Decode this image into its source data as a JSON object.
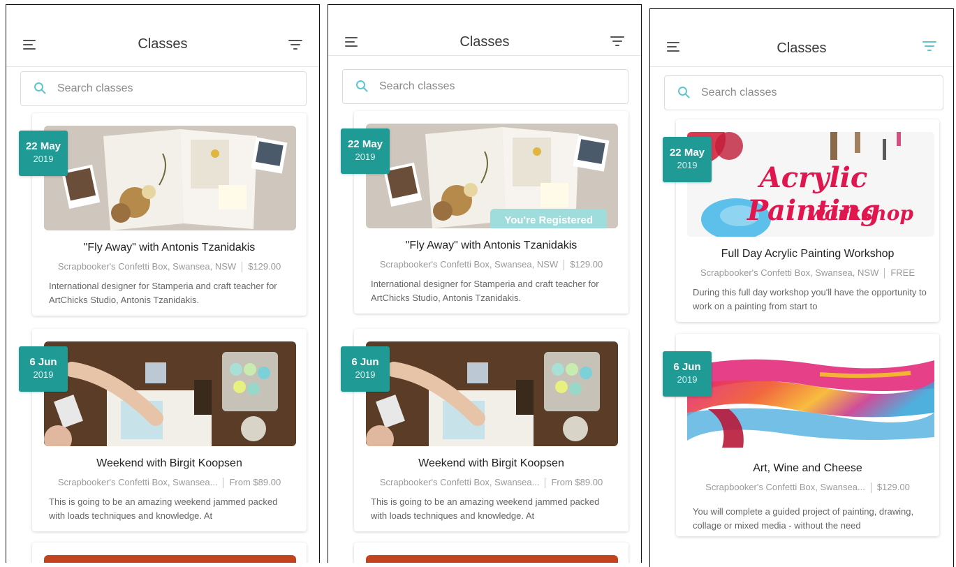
{
  "app": {
    "title": "Classes",
    "search_placeholder": "Search classes",
    "accent_color": "#1f9a95",
    "filter_active_color": "#5fc6cb"
  },
  "panels": [
    {
      "classes": [
        {
          "date_day": "22 May",
          "date_year": "2019",
          "title": "\"Fly Away\" with Antonis Tzanidakis",
          "location": "Scrapbooker's Confetti Box, Swansea, NSW",
          "price": "$129.00",
          "description": "International designer for Stamperia and craft teacher for ArtChicks Studio, Antonis Tzanidakis.",
          "image": "journal-flatlay"
        },
        {
          "date_day": "6 Jun",
          "date_year": "2019",
          "title": "Weekend with Birgit Koopsen",
          "location": "Scrapbooker's Confetti Box, Swansea...",
          "price": "From $89.00",
          "description": "This is going to be an amazing weekend jammed packed with loads techniques and knowledge. At",
          "image": "craft-desk"
        }
      ]
    },
    {
      "classes": [
        {
          "date_day": "22 May",
          "date_year": "2019",
          "title": "\"Fly Away\" with Antonis Tzanidakis",
          "location": "Scrapbooker's Confetti Box, Swansea, NSW",
          "price": "$129.00",
          "description": "International designer for Stamperia and craft teacher for ArtChicks Studio, Antonis Tzanidakis.",
          "badge": "You're Registered",
          "image": "journal-flatlay"
        },
        {
          "date_day": "6 Jun",
          "date_year": "2019",
          "title": "Weekend with Birgit Koopsen",
          "location": "Scrapbooker's Confetti Box, Swansea...",
          "price": "From $89.00",
          "description": "This is going to be an amazing weekend jammed packed with loads techniques and knowledge. At",
          "image": "craft-desk"
        }
      ]
    },
    {
      "classes": [
        {
          "date_day": "22 May",
          "date_year": "2019",
          "title": "Full Day Acrylic Painting Workshop",
          "location": "Scrapbooker's Confetti Box, Swansea, NSW",
          "price": "FREE",
          "description": "During this full day workshop you'll have the opportunity to work on a painting from start to",
          "image_text_line1": "Acrylic Painting",
          "image_text_line2": "workshop",
          "image": "acrylic-banner"
        },
        {
          "date_day": "6 Jun",
          "date_year": "2019",
          "title": "Art, Wine and Cheese",
          "location": "Scrapbooker's Confetti Box, Swansea...",
          "price": "$129.00",
          "description": "You will complete a guided project of painting, drawing, collage or mixed media - without the need",
          "image": "watercolor-stripes"
        }
      ]
    }
  ]
}
